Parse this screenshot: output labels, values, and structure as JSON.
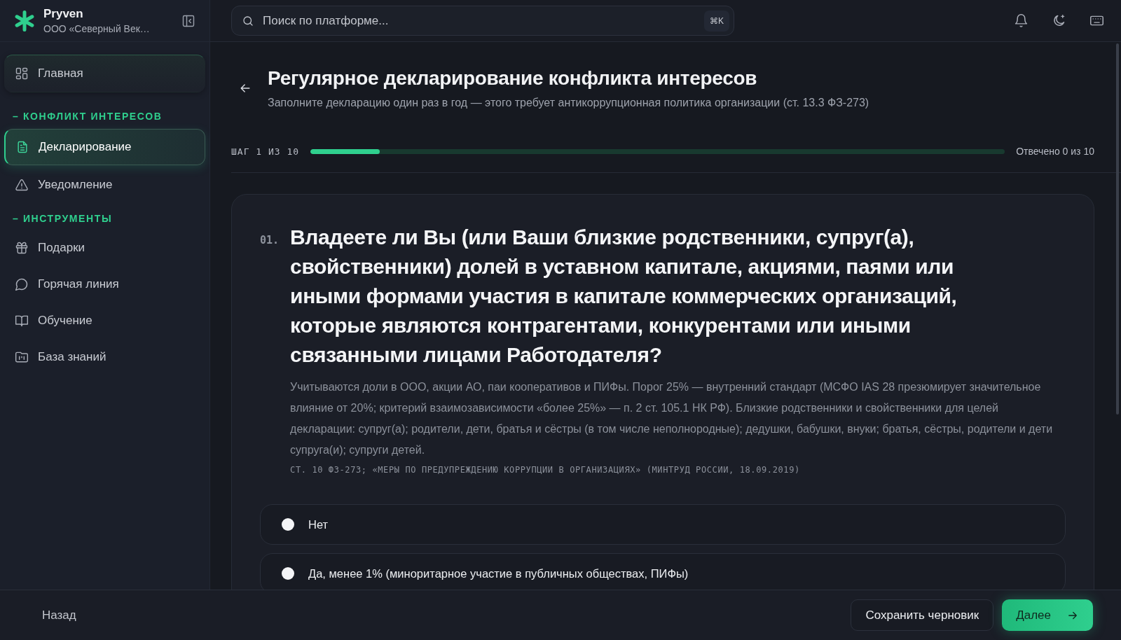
{
  "brand": {
    "name": "Pryven",
    "organization": "ООО «Северный Век…"
  },
  "sidebar": {
    "items": [
      {
        "label": "Главная",
        "kind": "pinned",
        "selected": false
      },
      {
        "label": "– КОНФЛИКТ ИНТЕРЕСОВ",
        "kind": "section"
      },
      {
        "label": "Декларирование",
        "kind": "link",
        "selected": true
      },
      {
        "label": "Уведомление",
        "kind": "link",
        "selected": false
      },
      {
        "label": "– ИНСТРУМЕНТЫ",
        "kind": "section"
      },
      {
        "label": "Подарки",
        "kind": "link",
        "selected": false
      },
      {
        "label": "Горячая линия",
        "kind": "link",
        "selected": false
      },
      {
        "label": "Обучение",
        "kind": "link",
        "selected": false
      },
      {
        "label": "База знаний",
        "kind": "link",
        "selected": false
      }
    ]
  },
  "search": {
    "placeholder": "Поиск по платформе...",
    "shortcut": "⌘K"
  },
  "page": {
    "title": "Регулярное декларирование конфликта интересов",
    "subtitle": "Заполните декларацию один раз в год — этого требует антикоррупционная политика организации (ст. 13.3 ФЗ-273)"
  },
  "progress": {
    "step": "ШАГ 1 ИЗ 10",
    "level": 0.1,
    "answered": "Отвечено 0 из 10"
  },
  "question": {
    "number": "01.",
    "text": "Владеете ли Вы (или Ваши близкие родственники, супруг(а), свойственники) долей в уставном капитале, акциями, паями или иными формами участия в капитале коммерческих организаций, которые являются контрагентами, конкурентами или иными связанными лицами Работодателя?",
    "hint": "Учитываются доли в ООО, акции АО, паи кооперативов и ПИФы. Порог 25% — внутренний стандарт (МСФО IAS 28 презюмирует значительное влияние от 20%; критерий взаимозависимости «более 25%» — п. 2 ст. 105.1 НК РФ). Близкие родственники и свойственники для целей декларации: супруг(а); родители, дети, братья и сёстры (в том числе неполнородные); дедушки, бабушки, внуки; братья, сёстры, родители и дети супруга(и); супруги детей.",
    "source": "СТ. 10 ФЗ-273; «МЕРЫ ПО ПРЕДУПРЕЖДЕНИЮ КОРРУПЦИИ В ОРГАНИЗАЦИЯХ» (МИНТРУД РОССИИ, 18.09.2019)",
    "options": [
      {
        "label": "Нет",
        "selected": false
      },
      {
        "label": "Да, менее 1% (миноритарное участие в публичных обществах, ПИФы)",
        "selected": false
      }
    ]
  },
  "footer": {
    "back": "Назад",
    "save": "Сохранить черновик",
    "next": "Далее"
  }
}
